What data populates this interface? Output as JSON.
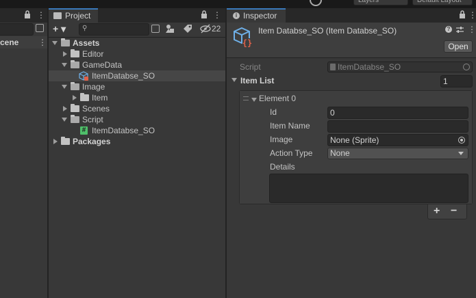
{
  "toolbar": {
    "layers_label": "Layers",
    "layout_label": "Default Layout"
  },
  "scene_panel": {
    "tab_partial": "cene"
  },
  "project": {
    "tab_label": "Project",
    "add_label": "+ ▾",
    "hidden_count": "22",
    "tree": {
      "assets": "Assets",
      "editor": "Editor",
      "gamedata": "GameData",
      "item_db": "ItemDatabse_SO",
      "image": "Image",
      "item": "Item",
      "scenes": "Scenes",
      "script": "Script",
      "script_file": "ItemDatabse_SO",
      "packages": "Packages"
    }
  },
  "inspector": {
    "tab_label": "Inspector",
    "title": "Item Databse_SO (Item Databse_SO)",
    "open_label": "Open",
    "script_label": "Script",
    "script_value": "ItemDatabse_SO",
    "item_list_label": "Item List",
    "item_list_count": "1",
    "element": {
      "label": "Element 0",
      "id_label": "Id",
      "id_value": "0",
      "item_name_label": "Item Name",
      "item_name_value": "",
      "image_label": "Image",
      "image_value": "None (Sprite)",
      "action_type_label": "Action Type",
      "action_type_value": "None",
      "details_label": "Details",
      "details_value": ""
    },
    "add_symbol": "+",
    "remove_symbol": "−"
  },
  "colors": {
    "accent": "#3a79bb",
    "panel": "#383838",
    "field": "#2a2a2a",
    "tabstrip": "#282828"
  },
  "icons": [
    "lock-icon",
    "kebab-menu-icon",
    "folder-icon",
    "search-icon",
    "filter-type-icon",
    "label-tag-icon",
    "hidden-eye-icon",
    "scriptable-object-icon",
    "cs-script-icon",
    "help-icon",
    "preset-icon",
    "object-picker-icon",
    "dropdown-arrow-icon",
    "drag-handle-icon",
    "info-icon"
  ]
}
